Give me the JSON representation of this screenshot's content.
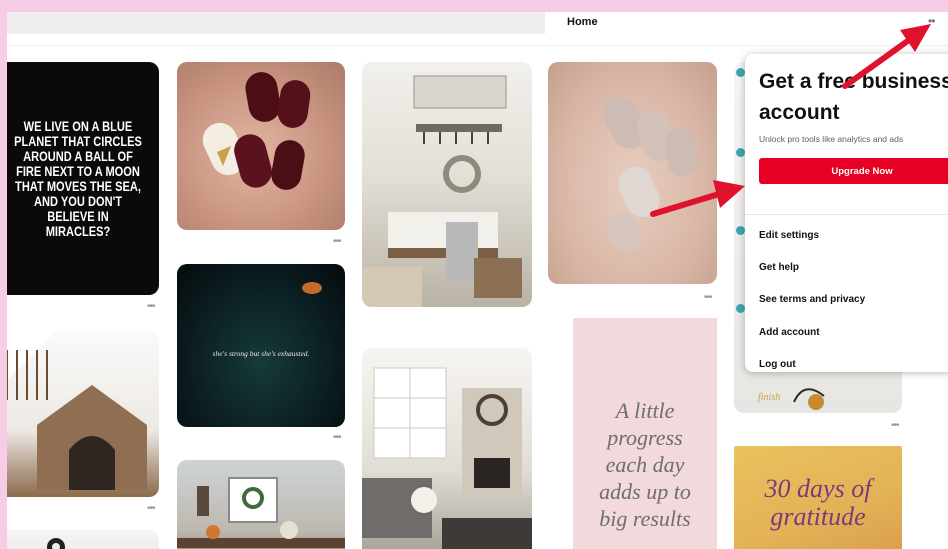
{
  "nav": {
    "home_label": "Home",
    "more_label": "••"
  },
  "pins": {
    "quote_text": "WE LIVE ON A BLUE PLANET THAT CIRCLES AROUND A BALL OF FIRE NEXT TO A MOON THAT MOVES THE SEA, AND YOU DON'T BELIEVE IN MIRACLES?",
    "night_text": "she's strong but she's exhausted.",
    "pink_text": "A little progress each day adds up to big results",
    "gratitude_text": "30 days of gratitude",
    "finish_text": "finish",
    "more_label": "•••"
  },
  "menu": {
    "title": "Get a free business account",
    "subtitle": "Unlock pro tools like analytics and ads",
    "upgrade_label": "Upgrade Now",
    "items": [
      {
        "label": "Edit settings"
      },
      {
        "label": "Get help"
      },
      {
        "label": "See terms and privacy"
      },
      {
        "label": "Add account"
      },
      {
        "label": "Log out"
      }
    ]
  },
  "colors": {
    "background": "#f6cde4",
    "accent": "#e60023",
    "arrow": "#e0112b"
  }
}
